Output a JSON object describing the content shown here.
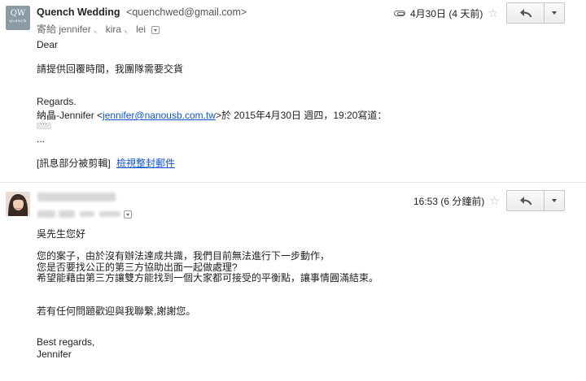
{
  "message1": {
    "sender_name": "Quench Wedding",
    "sender_email": "<quenchwed@gmail.com>",
    "avatar_text": "QW",
    "avatar_subtext": "quench",
    "to_label": "寄給",
    "recipients": [
      "jennifer",
      "kira",
      "lei"
    ],
    "date": "4月30日 (4 天前)",
    "has_attachment": true,
    "body": {
      "greeting": "Dear",
      "line1": "請提供回覆時間，我團隊需要交貨",
      "regards": "Regards.",
      "quote_prefix": "納晶-Jennifer <",
      "quote_email": "jennifer@nanousb.com.tw",
      "quote_suffix": ">於 2015年4月30日 週四，19:20寫道：",
      "ellipsis": "...",
      "clipped_label": "[訊息部分被剪輯]",
      "view_full_link": "檢視整封郵件"
    }
  },
  "message2": {
    "time": "16:53 (6 分鐘前)",
    "body": {
      "greeting": "吳先生您好",
      "p1": "您的案子，由於沒有辦法達成共識，我們目前無法進行下一步動作，",
      "p2": "您是否要找公正的第三方協助出面一起做處理?",
      "p3": "希望能藉由第三方讓雙方能找到一個大家都可接受的平衡點，讓事情圓滿結束。",
      "p4": "若有任何問題歡迎與我聯繫,謝謝您。",
      "closing": "Best regards,",
      "signature": "Jennifer"
    }
  },
  "colors": {
    "link": "#1155cc",
    "separator": "#e5e5e5",
    "star": "#bbbbbb"
  },
  "icons": {
    "reply": "reply-arrow-icon",
    "more": "chevron-down-icon",
    "star": "star-outline-icon",
    "attachment": "paperclip-icon"
  }
}
